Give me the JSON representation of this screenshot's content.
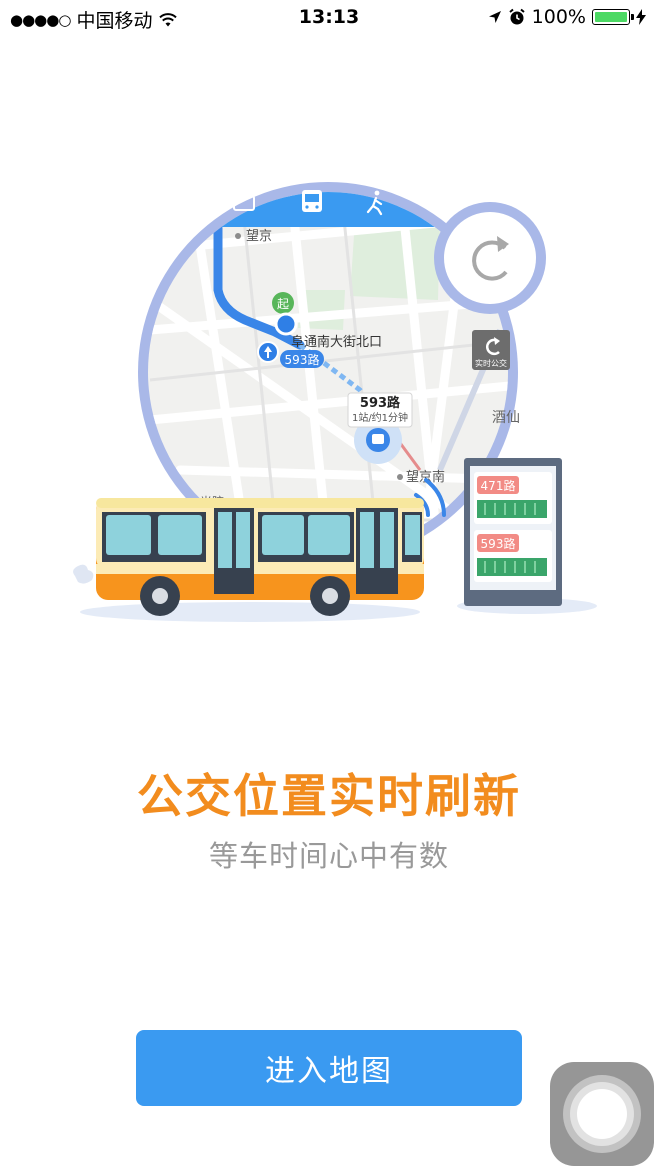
{
  "status_bar": {
    "signal_dots": "●●●●○",
    "carrier": "中国移动",
    "time": "13:13",
    "battery": "100%",
    "icons": [
      "wifi-icon",
      "location-arrow-icon",
      "alarm-icon",
      "battery-icon",
      "charging-bolt-icon"
    ]
  },
  "map": {
    "place_top": "望京",
    "place_start": "阜通南大街北口",
    "start_badge": "起",
    "route_label": "593路",
    "bus_popup_title": "593路",
    "bus_popup_sub": "1站/约1分钟",
    "place_station": "望京南",
    "realtime_button": "实时公交",
    "place_right": "酒仙",
    "place_bottom_left": "光院",
    "tabs": [
      "subway-icon",
      "bus-icon",
      "walk-icon"
    ]
  },
  "stop_board": {
    "line_1": "471路",
    "line_2": "593路"
  },
  "headline": "公交位置实时刷新",
  "subheadline": "等车时间心中有数",
  "enter_button": "进入地图",
  "colors": {
    "accent_blue": "#3a9af1",
    "title_orange": "#f28c1e",
    "subtitle_gray": "#999999",
    "ring_lavender": "#a9b8e8",
    "board_green": "#3aa56a",
    "board_red": "#f28b85",
    "bus_teal": "#8ed2dc",
    "bus_orange": "#f7941d"
  }
}
